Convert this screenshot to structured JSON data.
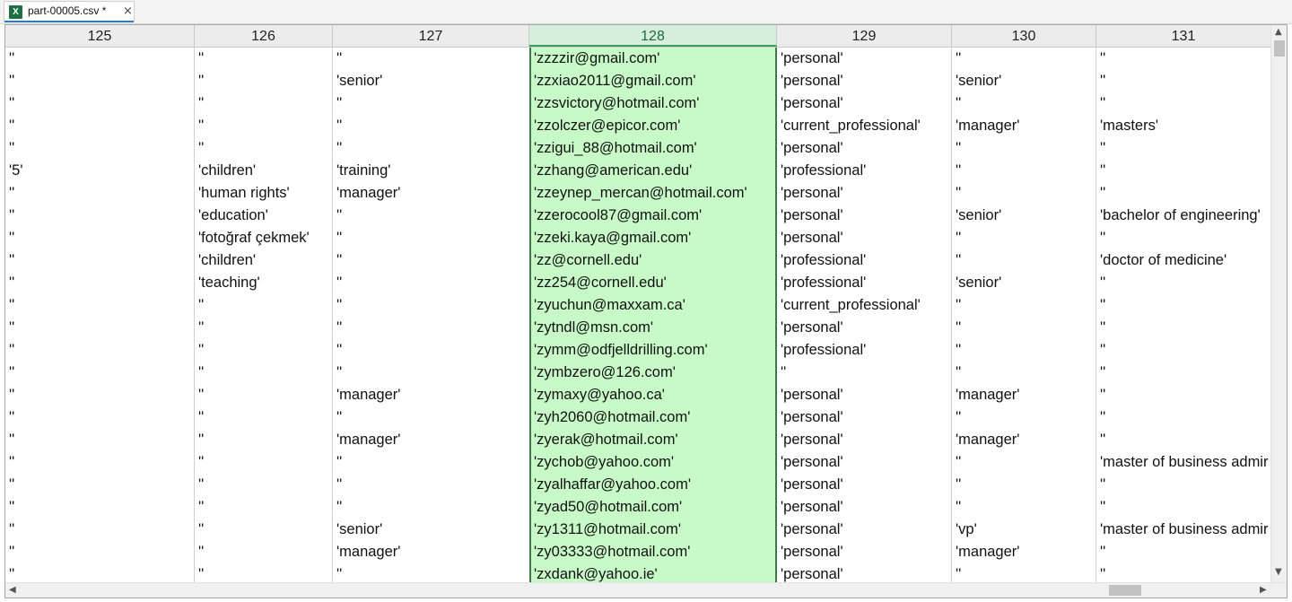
{
  "tab": {
    "icon_letter": "X",
    "label": "part-00005.csv *",
    "close": "×",
    "icon": "excel-file-icon"
  },
  "columns": [
    "125",
    "126",
    "127",
    "128",
    "129",
    "130",
    "131"
  ],
  "selected_column": "128",
  "rows": [
    [
      "''",
      "''",
      "''",
      "'zzzzir@gmail.com'",
      "'personal'",
      "''",
      "''"
    ],
    [
      "''",
      "''",
      "'senior'",
      "'zzxiao2011@gmail.com'",
      "'personal'",
      "'senior'",
      "''"
    ],
    [
      "''",
      "''",
      "''",
      "'zzsvictory@hotmail.com'",
      "'personal'",
      "''",
      "''"
    ],
    [
      "''",
      "''",
      "''",
      "'zzolczer@epicor.com'",
      "'current_professional'",
      "'manager'",
      "'masters'"
    ],
    [
      "''",
      "''",
      "''",
      "'zzigui_88@hotmail.com'",
      "'personal'",
      "''",
      "''"
    ],
    [
      "'5'",
      "'children'",
      "'training'",
      "'zzhang@american.edu'",
      "'professional'",
      "''",
      "''"
    ],
    [
      "''",
      "'human rights'",
      "'manager'",
      "'zzeynep_mercan@hotmail.com'",
      "'personal'",
      "''",
      "''"
    ],
    [
      "''",
      "'education'",
      "''",
      "'zzerocool87@gmail.com'",
      "'personal'",
      "'senior'",
      "'bachelor of engineering'"
    ],
    [
      "''",
      "'fotoğraf çekmek'",
      "''",
      "'zzeki.kaya@gmail.com'",
      "'personal'",
      "''",
      "''"
    ],
    [
      "''",
      "'children'",
      "''",
      "'zz@cornell.edu'",
      "'professional'",
      "''",
      "'doctor of medicine'"
    ],
    [
      "''",
      "'teaching'",
      "''",
      "'zz254@cornell.edu'",
      "'professional'",
      "'senior'",
      "''"
    ],
    [
      "''",
      "''",
      "''",
      "'zyuchun@maxxam.ca'",
      "'current_professional'",
      "''",
      "''"
    ],
    [
      "''",
      "''",
      "''",
      "'zytndl@msn.com'",
      "'personal'",
      "''",
      "''"
    ],
    [
      "''",
      "''",
      "''",
      "'zymm@odfjelldrilling.com'",
      "'professional'",
      "''",
      "''"
    ],
    [
      "''",
      "''",
      "''",
      "'zymbzero@126.com'",
      "''",
      "''",
      "''"
    ],
    [
      "''",
      "''",
      "'manager'",
      "'zymaxy@yahoo.ca'",
      "'personal'",
      "'manager'",
      "''"
    ],
    [
      "''",
      "''",
      "''",
      "'zyh2060@hotmail.com'",
      "'personal'",
      "''",
      "''"
    ],
    [
      "''",
      "''",
      "'manager'",
      "'zyerak@hotmail.com'",
      "'personal'",
      "'manager'",
      "''"
    ],
    [
      "''",
      "''",
      "''",
      "'zychob@yahoo.com'",
      "'personal'",
      "''",
      "'master of business admir"
    ],
    [
      "''",
      "''",
      "''",
      "'zyalhaffar@yahoo.com'",
      "'personal'",
      "''",
      "''"
    ],
    [
      "''",
      "''",
      "''",
      "'zyad50@hotmail.com'",
      "'personal'",
      "''",
      "''"
    ],
    [
      "''",
      "''",
      "'senior'",
      "'zy1311@hotmail.com'",
      "'personal'",
      "'vp'",
      "'master of business admir"
    ],
    [
      "''",
      "''",
      "'manager'",
      "'zy03333@hotmail.com'",
      "'personal'",
      "'manager'",
      "''"
    ],
    [
      "''",
      "''",
      "''",
      "'zxdank@yahoo.ie'",
      "'personal'",
      "''",
      "''"
    ]
  ],
  "scroll": {
    "up": "▲",
    "down": "▼",
    "left": "◀",
    "right": "▶"
  },
  "colors": {
    "selected_fill": "#c8fac8",
    "selected_border": "#3a7a4a",
    "tab_accent": "#2b7bd6"
  }
}
